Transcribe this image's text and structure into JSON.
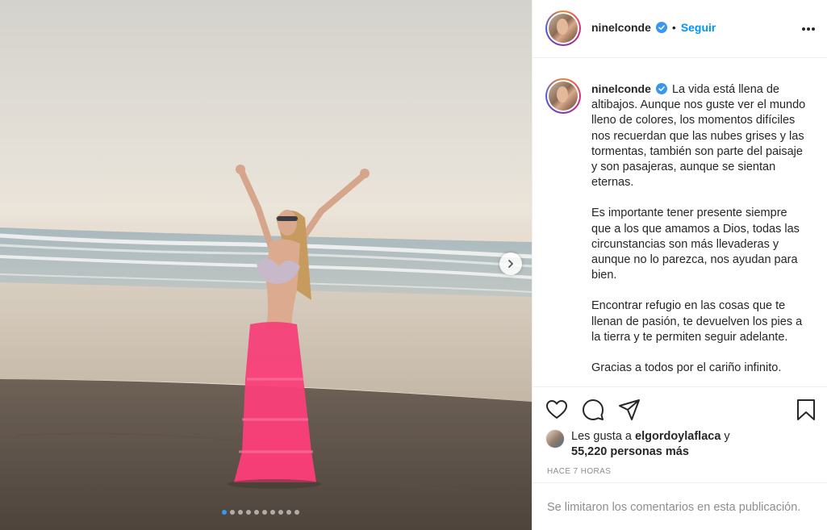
{
  "post": {
    "username": "ninelconde",
    "follow_label": "Seguir",
    "caption_paragraphs": [
      "La vida está llena de altibajos. Aunque nos guste ver el mundo lleno de colores, los momentos difíciles nos recuerdan que las nubes grises y las tormentas, también son parte del paisaje y son pasajeras, aunque se sientan eternas.",
      "Es importante tener presente siempre que a los que amamos a Dios, todas las circunstancias son más llevaderas y aunque no lo parezca, nos ayudan para bien.",
      "Encontrar refugio en las cosas que te llenan de pasión, te devuelven los pies a la tierra y te permiten seguir adelante.",
      "Gracias a todos por el cariño infinito."
    ],
    "likes_prefix": "Les gusta a",
    "likes_user": "elgordoylaflaca",
    "likes_conjunction": "y",
    "likes_count": "55,220 personas más",
    "timestamp": "HACE 7 HORAS",
    "comments_disabled": "Se limitaron los comentarios en esta publicación.",
    "carousel": {
      "slides": 10,
      "current": 1
    }
  },
  "icons": {
    "verified": "verified-badge-icon",
    "more": "more-options-icon",
    "like": "heart-icon",
    "comment": "comment-icon",
    "share": "share-icon",
    "save": "bookmark-icon",
    "next": "chevron-right-icon"
  },
  "colors": {
    "link": "#0095f6",
    "verified": "#3897f0",
    "text": "#262626",
    "muted": "#8e8e8e"
  }
}
